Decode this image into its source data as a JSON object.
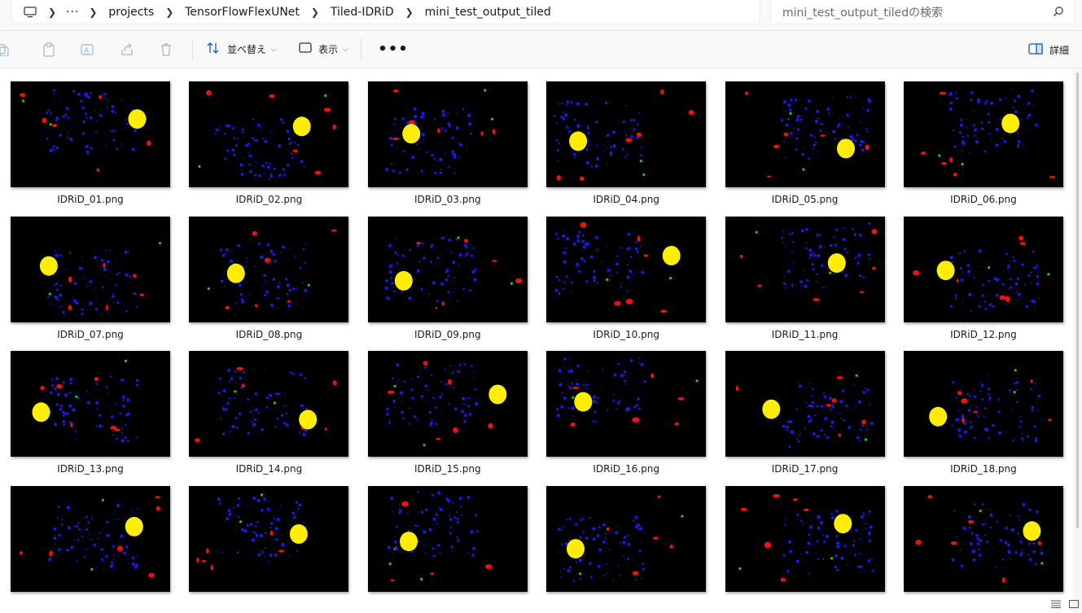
{
  "breadcrumb": {
    "more": "···",
    "items": [
      "projects",
      "TensorFlowFlexUNet",
      "Tiled-IDRiD",
      "mini_test_output_tiled"
    ]
  },
  "search": {
    "placeholder": "mini_test_output_tiledの検索"
  },
  "toolbar": {
    "sort_label": "並べ替え",
    "view_label": "表示",
    "more_label": "•••",
    "details_label": "詳細"
  },
  "files": [
    {
      "name": "IDRiD_01.png"
    },
    {
      "name": "IDRiD_02.png"
    },
    {
      "name": "IDRiD_03.png"
    },
    {
      "name": "IDRiD_04.png"
    },
    {
      "name": "IDRiD_05.png"
    },
    {
      "name": "IDRiD_06.png"
    },
    {
      "name": "IDRiD_07.png"
    },
    {
      "name": "IDRiD_08.png"
    },
    {
      "name": "IDRiD_09.png"
    },
    {
      "name": "IDRiD_10.png"
    },
    {
      "name": "IDRiD_11.png"
    },
    {
      "name": "IDRiD_12.png"
    },
    {
      "name": "IDRiD_13.png"
    },
    {
      "name": "IDRiD_14.png"
    },
    {
      "name": "IDRiD_15.png"
    },
    {
      "name": "IDRiD_16.png"
    },
    {
      "name": "IDRiD_17.png"
    },
    {
      "name": "IDRiD_18.png"
    },
    {
      "name": ""
    },
    {
      "name": ""
    },
    {
      "name": ""
    },
    {
      "name": ""
    },
    {
      "name": ""
    },
    {
      "name": ""
    }
  ],
  "colors": {
    "optic_disc": "#ffee00",
    "hard_exudate": "#1a1ae6",
    "hemorrhage": "#ee1111",
    "microaneurysm": "#22cc22",
    "thumb_bg": "#000000"
  }
}
